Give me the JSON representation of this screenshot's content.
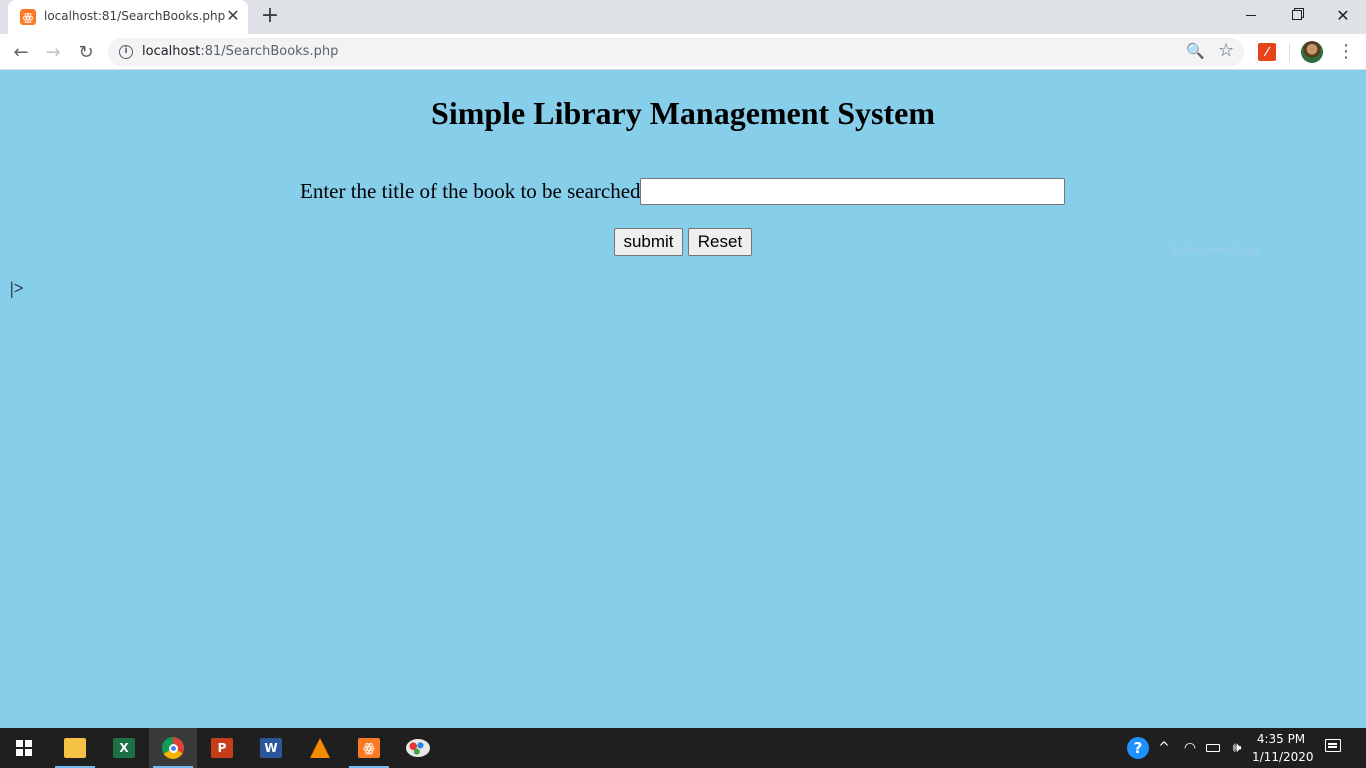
{
  "browser": {
    "tab": {
      "title": "localhost:81/SearchBooks.php",
      "favicon": "xampp-icon",
      "close_glyph": "✕"
    },
    "new_tab_glyph": "+",
    "window_controls": {
      "close_glyph": "✕"
    },
    "nav": {
      "back_glyph": "←",
      "forward_glyph": "→",
      "reload_glyph": "↻"
    },
    "address": {
      "host": "localhost",
      "path": ":81/SearchBooks.php",
      "info_glyph": "i"
    },
    "toolbar_icons": [
      "zoom-icon",
      "star-icon",
      "extension-icon",
      "avatar",
      "menu-icon"
    ],
    "zoom_glyph": "🔍",
    "star_glyph": "☆",
    "extension_glyph": "⁄",
    "menu_glyph": "⋮"
  },
  "page": {
    "background": "#87CEEB",
    "title": "Simple Library Management System",
    "search_label": "Enter the title of the book to be searched :",
    "search_value": "",
    "submit_label": "submit",
    "reset_label": "Reset",
    "stray_text": "|>",
    "snip_overlay": "Full-screen Snip"
  },
  "taskbar": {
    "apps": [
      {
        "name": "start",
        "active": false
      },
      {
        "name": "file-explorer",
        "active": false,
        "underline": true
      },
      {
        "name": "excel",
        "label": "X",
        "active": false
      },
      {
        "name": "chrome",
        "active": true,
        "underline": true
      },
      {
        "name": "powerpoint",
        "label": "P",
        "active": false
      },
      {
        "name": "word",
        "label": "W",
        "active": false
      },
      {
        "name": "vlc",
        "active": false
      },
      {
        "name": "xampp",
        "label": "ꙮ",
        "active": false,
        "underline": true
      },
      {
        "name": "paint",
        "active": false
      }
    ],
    "tray": {
      "help_glyph": "?",
      "chevron_glyph": "^",
      "wifi_glyph": "◠",
      "volume_glyph": "🕪"
    },
    "time": "4:35 PM",
    "date": "1/11/2020"
  }
}
